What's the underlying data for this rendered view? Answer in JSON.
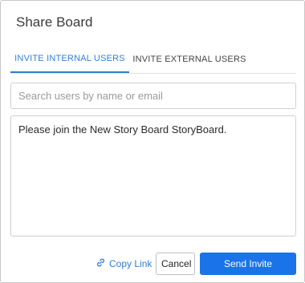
{
  "dialog": {
    "title": "Share Board"
  },
  "tabs": [
    {
      "label": "INVITE INTERNAL USERS",
      "active": true
    },
    {
      "label": "INVITE EXTERNAL USERS",
      "active": false
    }
  ],
  "search": {
    "placeholder": "Search users by name or email",
    "value": ""
  },
  "message": {
    "value": "Please join the New Story Board StoryBoard."
  },
  "actions": {
    "copy_link_label": "Copy Link",
    "copy_link_icon": "link-icon",
    "cancel_label": "Cancel",
    "send_label": "Send Invite"
  },
  "colors": {
    "accent": "#1a73e8",
    "tab_active": "#2f80d6"
  }
}
